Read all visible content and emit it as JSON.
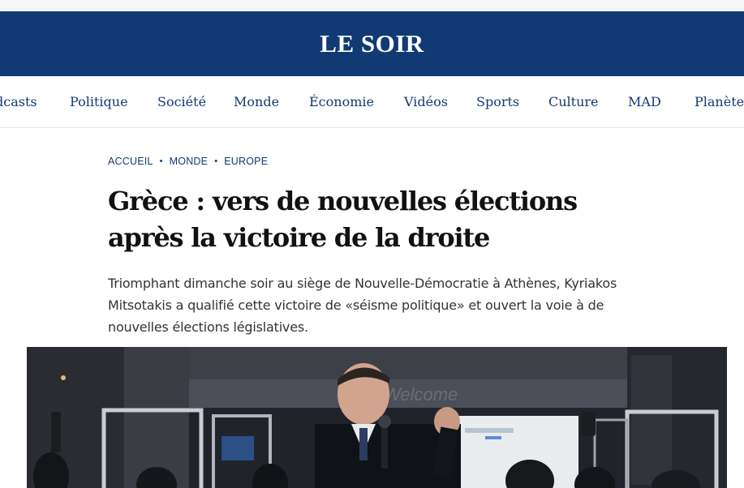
{
  "masthead": {
    "logo": "LE SOIR"
  },
  "nav": {
    "items": [
      {
        "label": "dcasts",
        "name": "nav-item-podcasts"
      },
      {
        "label": "Politique",
        "name": "nav-item-politique"
      },
      {
        "label": "Société",
        "name": "nav-item-societe"
      },
      {
        "label": "Monde",
        "name": "nav-item-monde"
      },
      {
        "label": "Économie",
        "name": "nav-item-economie"
      },
      {
        "label": "Vidéos",
        "name": "nav-item-videos"
      },
      {
        "label": "Sports",
        "name": "nav-item-sports"
      },
      {
        "label": "Culture",
        "name": "nav-item-culture"
      },
      {
        "label": "MAD",
        "name": "nav-item-mad"
      },
      {
        "label": "Planète",
        "name": "nav-item-planete"
      }
    ]
  },
  "breadcrumb": {
    "items": [
      "ACCUEIL",
      "MONDE",
      "EUROPE"
    ],
    "separator": "•"
  },
  "article": {
    "headline": "Grèce : vers de nouvelles élections après la victoire de la droite",
    "lede": "Triomphant dimanche soir au siège de Nouvelle-Démocratie à Athènes, Kyriakos Mitsotakis a qualifié cette victoire de «séisme politique» et ouvert la voie à de nouvelles élections législatives."
  },
  "photo": {
    "sign_text": "Welcome"
  },
  "colors": {
    "brand": "#113a75",
    "nav_text": "#123a72",
    "headline": "#111111",
    "body": "#333333"
  }
}
